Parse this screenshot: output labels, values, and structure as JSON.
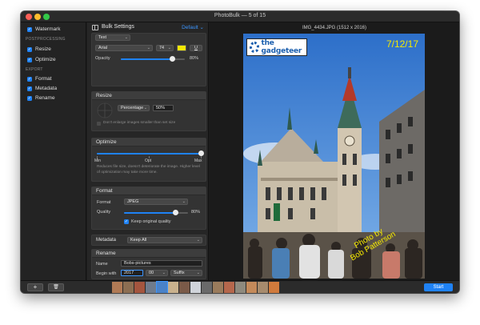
{
  "window": {
    "title": "PhotoBulk — 5 of 15"
  },
  "sidebar": {
    "items": [
      {
        "label": "Watermark"
      },
      {
        "label": "Resize"
      },
      {
        "label": "Optimize"
      },
      {
        "label": "Format"
      },
      {
        "label": "Metadata"
      },
      {
        "label": "Rename"
      }
    ],
    "sections": {
      "postprocessing": "POSTPROCESSING",
      "export": "EXPORT"
    }
  },
  "settings": {
    "title": "Bulk Settings",
    "preset": "Default",
    "watermark": {
      "type": "Text",
      "font": "Arial",
      "size": "74",
      "color": "#f5e900",
      "underline": "U",
      "opacity_label": "Opacity",
      "opacity_value": "80%",
      "opacity_fraction": 0.8
    },
    "resize": {
      "title": "Resize",
      "mode": "Percentage",
      "value": "50%",
      "note": "Don't enlarge images smaller than set size"
    },
    "optimize": {
      "title": "Optimize",
      "min": "Min",
      "opt": "Opt",
      "max": "Max",
      "level_fraction": 1.0,
      "note": "Reduces file size, doesn't deteriorate the image. Higher level of optimization may take more time."
    },
    "format": {
      "title": "Format",
      "format_label": "Format",
      "format_value": "JPEG",
      "quality_label": "Quality",
      "quality_value": "80%",
      "quality_fraction": 0.8,
      "keep_original": "Keep original quality"
    },
    "metadata": {
      "label": "Metadata",
      "value": "Keep All"
    },
    "rename": {
      "title": "Rename",
      "name_label": "Name",
      "name_value": "Bobs-pictures",
      "begin_label": "Begin with",
      "begin_value": "2017",
      "digits": "00",
      "position": "Suffix"
    }
  },
  "preview": {
    "image_name": "IMG_4434.JPG (1512 x 2016)",
    "watermark_logo": "the gadgeteer",
    "date_text": "7/12/17",
    "watermark_text_line1": "Photo by",
    "watermark_text_line2": "Bob Patterson"
  },
  "bottom": {
    "add_label": "+",
    "delete_icon": "trash-icon",
    "start_label": "Start"
  },
  "colors": {
    "accent": "#1f82f5",
    "watermark_yellow": "#f5e900"
  }
}
